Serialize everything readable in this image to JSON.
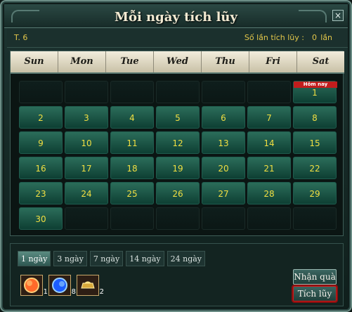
{
  "window": {
    "title": "Mỗi ngày tích lũy",
    "close": "×"
  },
  "info": {
    "month": "T. 6",
    "count_label": "Số lần tích lũy :",
    "count_value": "0",
    "count_unit": "lần"
  },
  "weekdays": [
    "Sun",
    "Mon",
    "Tue",
    "Wed",
    "Thu",
    "Fri",
    "Sat"
  ],
  "today_badge": "Hôm nay",
  "days": [
    [
      "",
      "",
      "",
      "",
      "",
      "",
      "1"
    ],
    [
      "2",
      "3",
      "4",
      "5",
      "6",
      "7",
      "8"
    ],
    [
      "9",
      "10",
      "11",
      "12",
      "13",
      "14",
      "15"
    ],
    [
      "16",
      "17",
      "18",
      "19",
      "20",
      "21",
      "22"
    ],
    [
      "23",
      "24",
      "25",
      "26",
      "27",
      "28",
      "29"
    ],
    [
      "30",
      "",
      "",
      "",
      "",
      "",
      ""
    ]
  ],
  "tabs": [
    "1 ngày",
    "3 ngày",
    "7 ngày",
    "14 ngày",
    "24 ngày"
  ],
  "items": [
    {
      "icon": "red-orb-icon",
      "qty": "1"
    },
    {
      "icon": "blue-sphere-icon",
      "qty": "8"
    },
    {
      "icon": "gold-ingot-icon",
      "qty": "2"
    }
  ],
  "buttons": {
    "receive": "Nhận quà",
    "accumulate": "Tích lũy"
  },
  "colors": {
    "accent": "#f1df42",
    "today": "#c21d1d",
    "highlight": "#cf1a1a"
  }
}
